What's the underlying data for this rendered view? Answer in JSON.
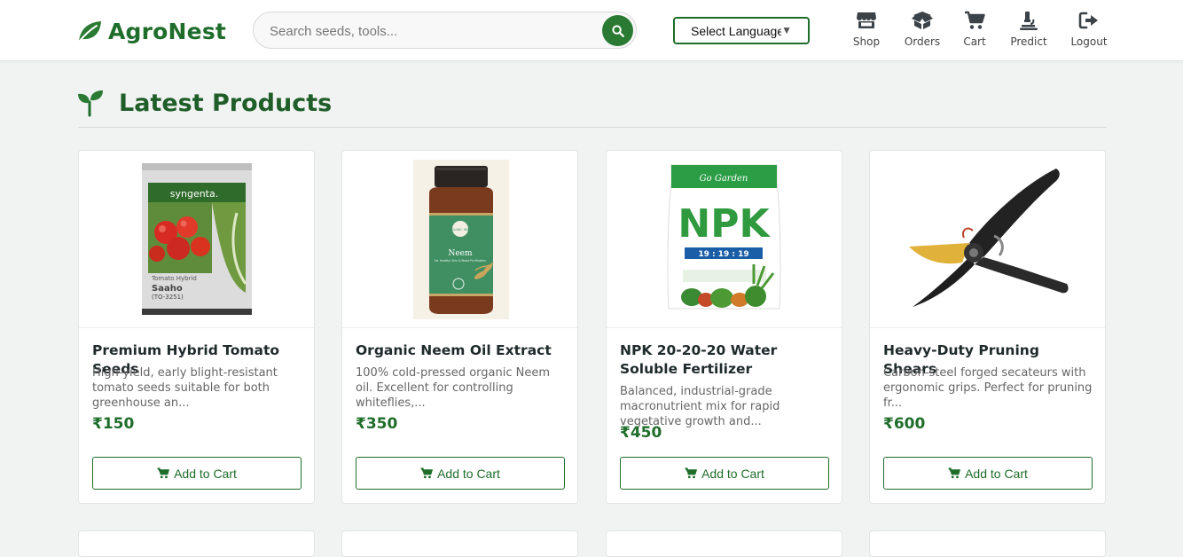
{
  "brand": {
    "name": "AgroNest",
    "icon": "leaf-icon",
    "color": "#1f6d2b"
  },
  "search": {
    "placeholder": "Search seeds, tools...",
    "value": "",
    "button_icon": "search-icon"
  },
  "language": {
    "selected": "Select Language",
    "caret": "▼"
  },
  "nav": [
    {
      "label": "Shop",
      "icon": "store-icon"
    },
    {
      "label": "Orders",
      "icon": "box-icon"
    },
    {
      "label": "Cart",
      "icon": "cart-icon"
    },
    {
      "label": "Predict",
      "icon": "microscope-icon"
    },
    {
      "label": "Logout",
      "icon": "logout-icon"
    }
  ],
  "section": {
    "title": "Latest Products",
    "icon": "seedling-icon"
  },
  "products": [
    {
      "title": "Premium Hybrid Tomato Seeds",
      "description": "High-yield, early blight-resistant tomato seeds suitable for both greenhouse an...",
      "price": "₹150",
      "button": "Add to Cart",
      "image_text": {
        "brand": "syngenta.",
        "line1": "Tomato Hybrid",
        "line2": "Saaho",
        "line3": "(TO-3251)"
      }
    },
    {
      "title": "Organic Neem Oil Extract",
      "description": "100% cold-pressed organic Neem oil. Excellent for controlling whiteflies,...",
      "price": "₹350",
      "button": "Add to Cart",
      "image_text": {
        "brand": "ORGANIC INDIA",
        "line1": "Neem",
        "line2": "For Healthy Skin & Blood Purification"
      }
    },
    {
      "title": "NPK 20-20-20 Water Soluble Fertilizer",
      "description": "Balanced, industrial-grade macronutrient mix for rapid vegetative growth and...",
      "price": "₹450",
      "button": "Add to Cart",
      "image_text": {
        "brand": "Go Garden",
        "line1": "NPK",
        "line2": "19 : 19 : 19"
      }
    },
    {
      "title": "Heavy-Duty Pruning Shears",
      "description": "Carbon-steel forged secateurs with ergonomic grips. Perfect for pruning fr...",
      "price": "₹600",
      "button": "Add to Cart"
    }
  ],
  "colors": {
    "accent": "#1f6d2b",
    "background": "#f1f3f2",
    "price": "#1f6d2b"
  }
}
